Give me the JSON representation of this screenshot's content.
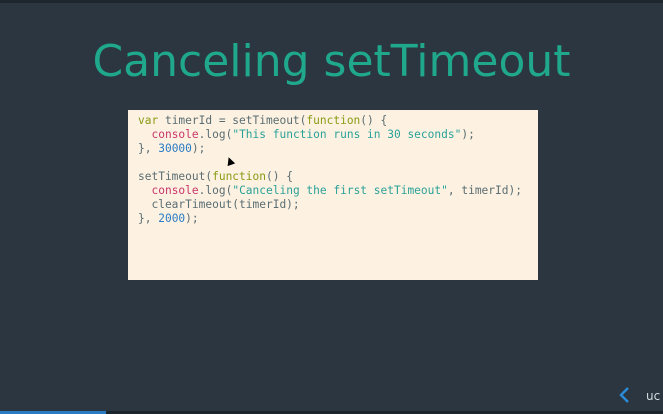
{
  "slide": {
    "title": "Canceling setTimeout"
  },
  "code": {
    "line1": {
      "kw": "var",
      "rest": " timerId = setTimeout(",
      "fn": "function",
      "tail": "() {"
    },
    "line2": {
      "indent": "  ",
      "obj": "console",
      "mid": ".log(",
      "str": "\"This function runs in 30 seconds\"",
      "tail": ");"
    },
    "line3": {
      "head": "}, ",
      "num": "30000",
      "tail": ");"
    },
    "line5": {
      "head": "setTimeout(",
      "fn": "function",
      "tail": "() {"
    },
    "line6": {
      "indent": "  ",
      "obj": "console",
      "mid": ".log(",
      "str": "\"Canceling the first setTimeout\"",
      "tail": ", timerId);"
    },
    "line7": {
      "text": "  clearTimeout(timerId);"
    },
    "line8": {
      "head": "}, ",
      "num": "2000",
      "tail": ");"
    }
  },
  "nav": {
    "prev_icon": "chevron-left",
    "next_partial": "uc"
  },
  "progress": {
    "fraction": 0.16
  },
  "colors": {
    "background": "#2b3640",
    "title": "#1fa88c",
    "code_background": "#fdf2e2",
    "keyword": "#8a9a14",
    "console": "#c8346a",
    "string": "#2aa198",
    "number": "#2a7bc4"
  }
}
